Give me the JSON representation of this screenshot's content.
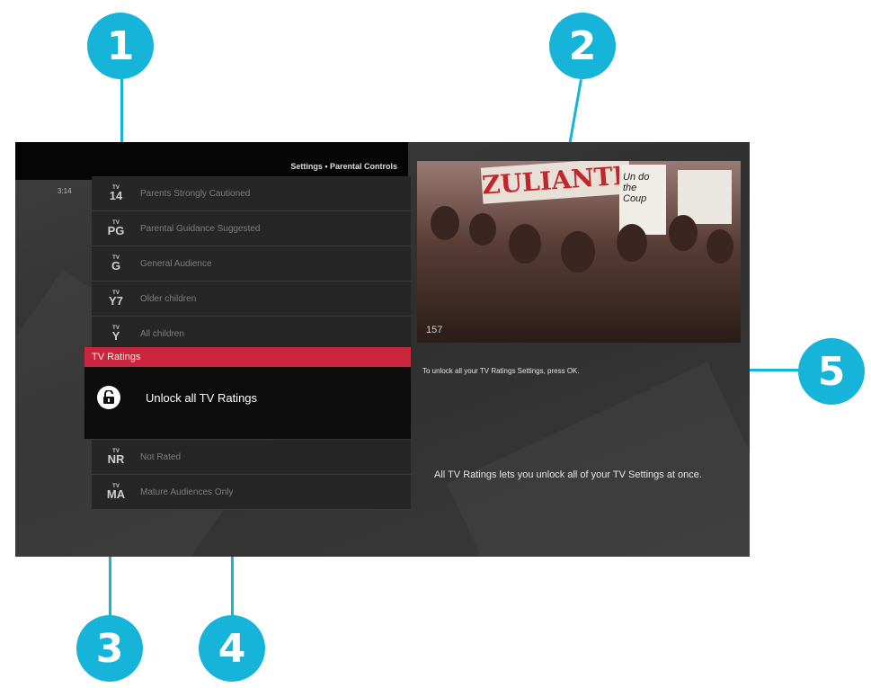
{
  "callouts": [
    "1",
    "2",
    "3",
    "4",
    "5"
  ],
  "header": {
    "breadcrumb": "Settings • Parental Controls",
    "clock": "3:14"
  },
  "ratings_above": [
    {
      "tv": "TV",
      "code": "14",
      "label": "Parents Strongly Cautioned"
    },
    {
      "tv": "TV",
      "code": "PG",
      "label": "Parental Guidance Suggested"
    },
    {
      "tv": "TV",
      "code": "G",
      "label": "General Audience"
    },
    {
      "tv": "TV",
      "code": "Y7",
      "label": "Older children"
    },
    {
      "tv": "TV",
      "code": "Y",
      "label": "All children"
    }
  ],
  "panel": {
    "heading": "TV Ratings",
    "title": "Unlock all TV Ratings"
  },
  "ratings_below": [
    {
      "tv": "TV",
      "code": "NR",
      "label": "Not Rated"
    },
    {
      "tv": "TV",
      "code": "MA",
      "label": "Mature Audiences Only"
    }
  ],
  "preview": {
    "channel": "157",
    "sign_text": "ZULIANTE",
    "sign2": "Un do the Coup"
  },
  "info": {
    "hint": "To unlock all your TV Ratings Settings, press OK.",
    "description": "All TV Ratings lets you unlock all of your TV Settings at once."
  },
  "colors": {
    "callout": "#16b4d8",
    "accent": "#c8263c"
  }
}
